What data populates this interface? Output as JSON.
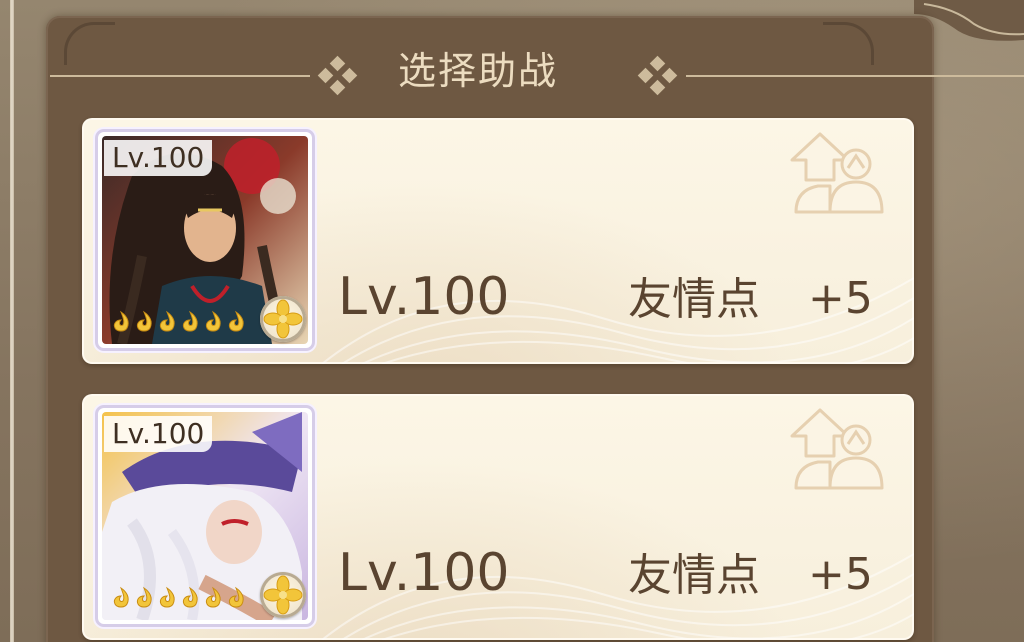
{
  "header": {
    "title": "选择助战"
  },
  "helpers": [
    {
      "portrait_level": "Lv.100",
      "star_count": 6,
      "level": "Lv.100",
      "friendship_label": "友情点",
      "friendship_value": "+5",
      "element_icon": "golden-flower-icon",
      "action_icon": "support-up-icon"
    },
    {
      "portrait_level": "Lv.100",
      "star_count": 6,
      "level": "Lv.100",
      "friendship_label": "友情点",
      "friendship_value": "+5",
      "element_icon": "golden-flower-icon",
      "action_icon": "support-up-icon"
    }
  ],
  "colors": {
    "panel": "#6e5842",
    "card": "#f8f1df",
    "text": "#5a4430",
    "title": "#ecdcc0",
    "star": "#f2c53a"
  }
}
